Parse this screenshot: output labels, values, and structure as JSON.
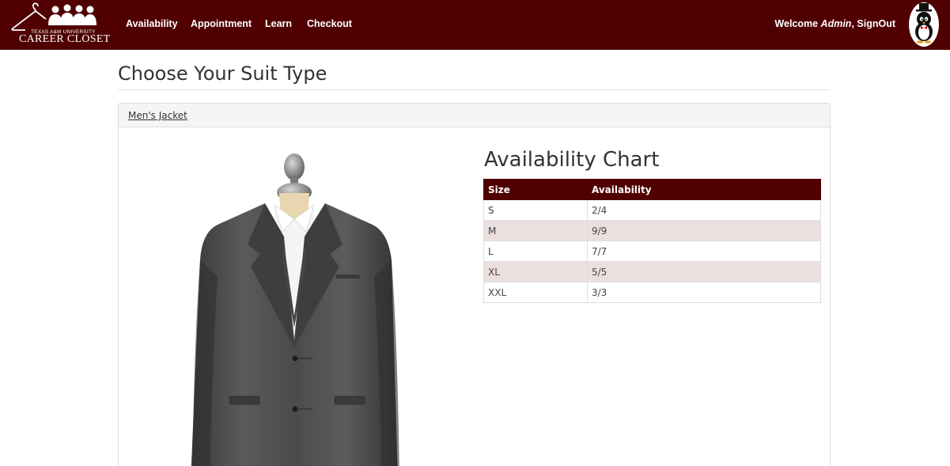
{
  "brand": {
    "university": "TEXAS A&M UNIVERSITY",
    "name": "CAREER CLOSET"
  },
  "nav": {
    "items": [
      {
        "label": "Availability"
      },
      {
        "label": "Appointment"
      },
      {
        "label": "Learn"
      },
      {
        "label": "Checkout"
      }
    ],
    "welcome_prefix": "Welcome ",
    "user": "Admin",
    "signout": ", SignOut"
  },
  "page": {
    "title": "Choose Your Suit Type"
  },
  "panel": {
    "heading": "Men's Jacket",
    "chart_title": "Availability Chart",
    "table": {
      "headers": [
        "Size",
        "Availability"
      ],
      "rows": [
        {
          "size": "S",
          "availability": "2/4"
        },
        {
          "size": "M",
          "availability": "9/9"
        },
        {
          "size": "L",
          "availability": "7/7"
        },
        {
          "size": "XL",
          "availability": "5/5"
        },
        {
          "size": "XXL",
          "availability": "3/3"
        }
      ]
    }
  },
  "colors": {
    "brand": "#500000",
    "row_stripe": "#ecdfe0"
  },
  "icons": {
    "logo": "hanger-people-logo",
    "avatar": "penguin-top-hat-avatar"
  }
}
